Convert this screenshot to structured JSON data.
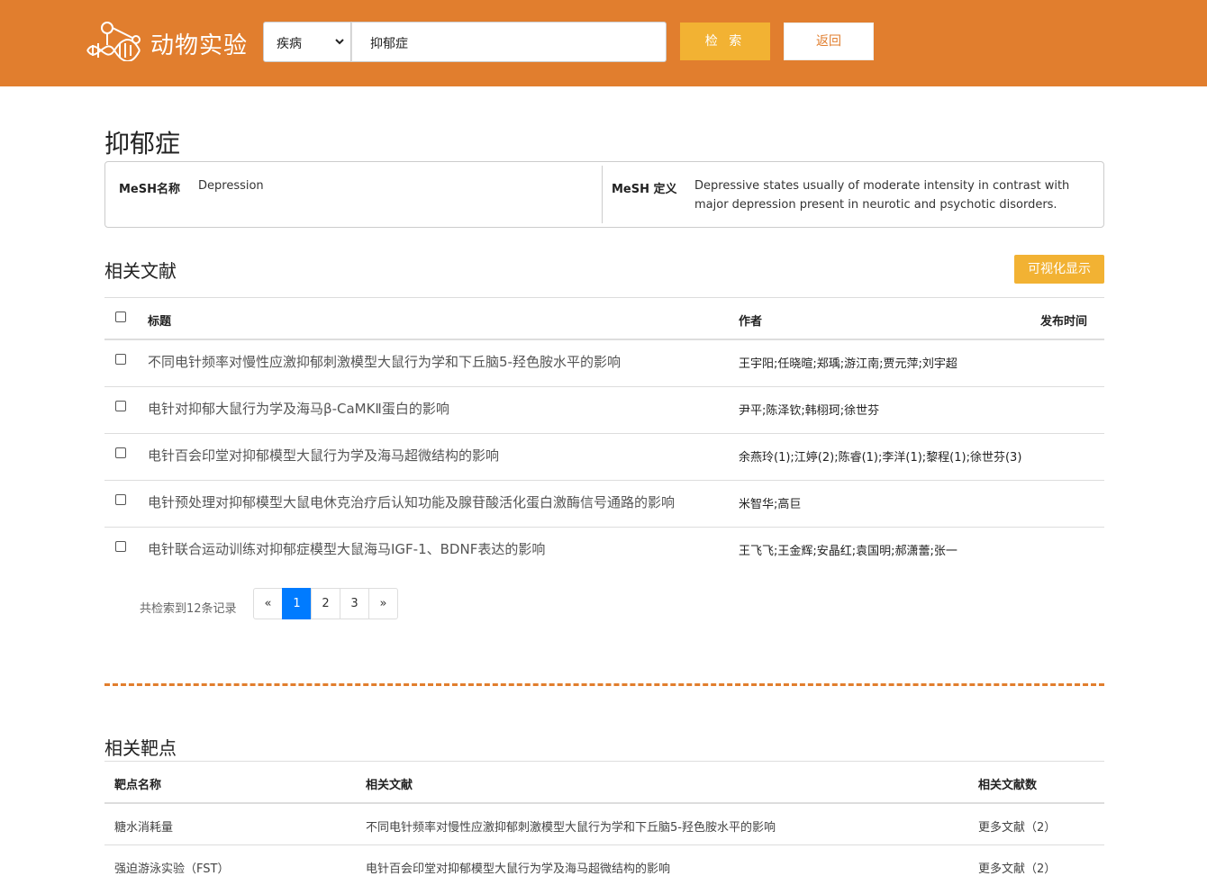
{
  "header": {
    "brand": "动物实验",
    "search_type": "疾病",
    "search_value": "抑郁症",
    "search_button": "检 索",
    "back_button": "返回"
  },
  "disease": {
    "title": "抑郁症",
    "mesh_name_label": "MeSH名称",
    "mesh_name": "Depression",
    "mesh_def_label": "MeSH 定义",
    "mesh_def": "Depressive states usually of moderate intensity in contrast with major depression present in neurotic and psychotic disorders."
  },
  "literature": {
    "section_title": "相关文献",
    "viz_button": "可视化显示",
    "columns": {
      "title": "标题",
      "author": "作者",
      "date": "发布时间"
    },
    "rows": [
      {
        "title": "不同电针频率对慢性应激抑郁刺激模型大鼠行为学和下丘脑5-羟色胺水平的影响",
        "author": "王宇阳;任晓暄;郑瑀;游江南;贾元萍;刘宇超",
        "date": ""
      },
      {
        "title": "电针对抑郁大鼠行为学及海马β-CaMKⅡ蛋白的影响",
        "author": "尹平;陈泽钦;韩栩珂;徐世芬",
        "date": ""
      },
      {
        "title": "电针百会印堂对抑郁模型大鼠行为学及海马超微结构的影响",
        "author": "余燕玲(1);江婷(2);陈睿(1);李洋(1);黎程(1);徐世芬(3)",
        "date": ""
      },
      {
        "title": "电针预处理对抑郁模型大鼠电休克治疗后认知功能及腺苷酸活化蛋白激酶信号通路的影响",
        "author": "米智华;高巨",
        "date": ""
      },
      {
        "title": "电针联合运动训练对抑郁症模型大鼠海马IGF-1、BDNF表达的影响",
        "author": "王飞飞;王金辉;安晶红;袁国明;郝潇蕾;张一",
        "date": ""
      }
    ],
    "total_text": "共检索到12条记录",
    "pagination": {
      "prev": "«",
      "pages": [
        "1",
        "2",
        "3"
      ],
      "next": "»",
      "current": "1"
    }
  },
  "targets": {
    "section_title": "相关靶点",
    "columns": {
      "name": "靶点名称",
      "literature": "相关文献",
      "count": "相关文献数"
    },
    "rows": [
      {
        "name": "糖水消耗量",
        "literature": "不同电针频率对慢性应激抑郁刺激模型大鼠行为学和下丘脑5-羟色胺水平的影响",
        "count": "更多文献（2）"
      },
      {
        "name": "强迫游泳实验（FST）",
        "literature": "电针百会印堂对抑郁模型大鼠行为学及海马超微结构的影响",
        "count": "更多文献（2）"
      }
    ]
  }
}
